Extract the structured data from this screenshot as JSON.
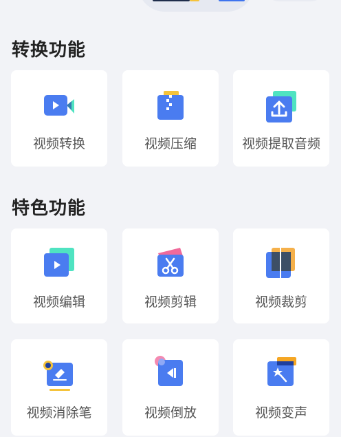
{
  "sections": [
    {
      "title": "转换功能",
      "items": [
        {
          "label": "视频转换",
          "icon": "video-camera-icon"
        },
        {
          "label": "视频压缩",
          "icon": "zip-compress-icon"
        },
        {
          "label": "视频提取音频",
          "icon": "upload-extract-icon"
        }
      ]
    },
    {
      "title": "特色功能",
      "items": [
        {
          "label": "视频编辑",
          "icon": "play-edit-icon"
        },
        {
          "label": "视频剪辑",
          "icon": "scissors-icon"
        },
        {
          "label": "视频裁剪",
          "icon": "crop-icon"
        },
        {
          "label": "视频消除笔",
          "icon": "eraser-icon"
        },
        {
          "label": "视频倒放",
          "icon": "reverse-play-icon"
        },
        {
          "label": "视频变声",
          "icon": "magic-voice-icon"
        }
      ]
    }
  ],
  "colors": {
    "primary": "#4a7cf0",
    "teal": "#4fe3c1",
    "yellow": "#f5c33b",
    "orange": "#f5a623",
    "pink": "#f06a9b",
    "navy": "#1f2d4b"
  }
}
